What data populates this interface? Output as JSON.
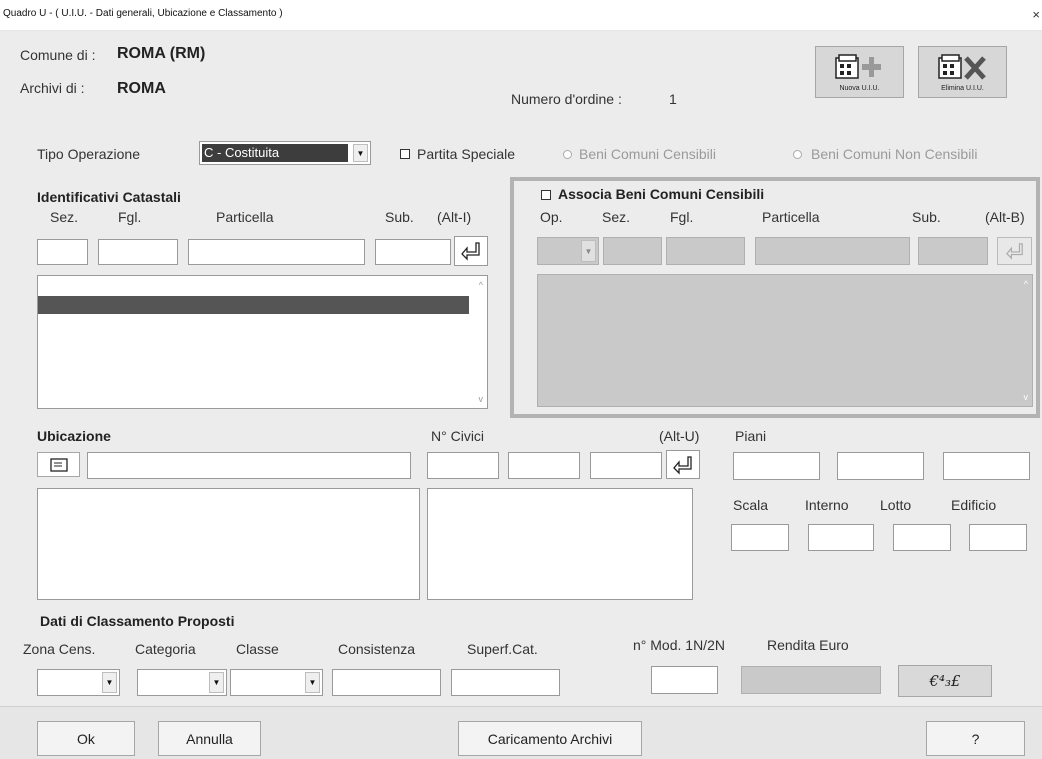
{
  "window": {
    "title": "Quadro U - ( U.I.U. - Dati generali, Ubicazione e Classamento )",
    "close_glyph": "×"
  },
  "header": {
    "comune_label": "Comune di  :",
    "comune_value": "ROMA (RM)",
    "archivi_label": "Archivi di   :",
    "archivi_value": "ROMA",
    "numero_ordine_label": "Numero d'ordine :",
    "numero_ordine_value": "1",
    "nuova_label": "Nuova U.I.U.",
    "elimina_label": "Elimina U.I.U."
  },
  "tipo_operazione": {
    "label": "Tipo Operazione",
    "value": "C - Costituita",
    "partita_speciale": "Partita Speciale",
    "beni_comuni_censibili": "Beni Comuni Censibili",
    "beni_comuni_non_censibili": "Beni Comuni Non Censibili"
  },
  "identificativi": {
    "title": "Identificativi Catastali",
    "sez": "Sez.",
    "fgl": "Fgl.",
    "particella": "Particella",
    "sub": "Sub.",
    "shortcut": "(Alt-I)"
  },
  "associa": {
    "title": "Associa Beni Comuni Censibili",
    "op": "Op.",
    "sez": "Sez.",
    "fgl": "Fgl.",
    "particella": "Particella",
    "sub": "Sub.",
    "shortcut": "(Alt-B)"
  },
  "ubicazione": {
    "title": "Ubicazione",
    "civici": "N° Civici",
    "shortcut": "(Alt-U)",
    "piani": "Piani",
    "scala": "Scala",
    "interno": "Interno",
    "lotto": "Lotto",
    "edificio": "Edificio"
  },
  "classamento": {
    "title": "Dati di Classamento Proposti",
    "zona": "Zona Cens.",
    "categoria": "Categoria",
    "classe": "Classe",
    "consistenza": "Consistenza",
    "superf": "Superf.Cat.",
    "mod": "n° Mod. 1N/2N",
    "rendita": "Rendita  Euro",
    "currency_glyph": "€⁴₃£"
  },
  "buttons": {
    "ok": "Ok",
    "annulla": "Annulla",
    "caricamento": "Caricamento Archivi",
    "help": "?"
  }
}
